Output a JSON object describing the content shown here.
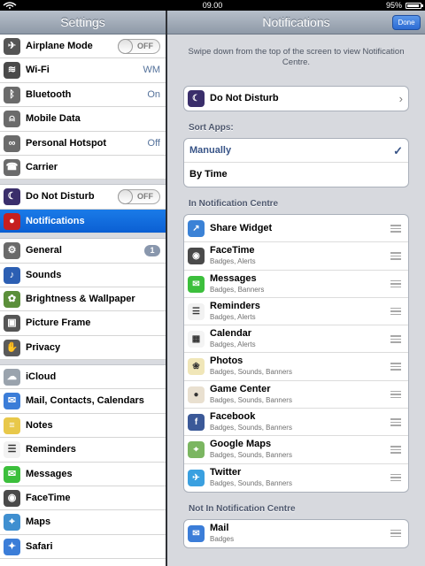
{
  "status": {
    "time": "09.00",
    "battery_text": "95%",
    "battery_level": 0.95
  },
  "left": {
    "title": "Settings",
    "groups": [
      [
        {
          "label": "Airplane Mode",
          "icon": "airplane-icon",
          "color": "#555555",
          "toggle": "OFF"
        },
        {
          "label": "Wi-Fi",
          "icon": "wifi-icon",
          "color": "#4a4a4a",
          "value": "WM"
        },
        {
          "label": "Bluetooth",
          "icon": "bluetooth-icon",
          "color": "#6b6b6b",
          "value": "On"
        },
        {
          "label": "Mobile Data",
          "icon": "mobile-data-icon",
          "color": "#6b6b6b"
        },
        {
          "label": "Personal Hotspot",
          "icon": "hotspot-icon",
          "color": "#6b6b6b",
          "value": "Off"
        },
        {
          "label": "Carrier",
          "icon": "phone-icon",
          "color": "#6b6b6b"
        }
      ],
      [
        {
          "label": "Do Not Disturb",
          "icon": "moon-icon",
          "color": "#3a2e6b",
          "toggle": "OFF"
        },
        {
          "label": "Notifications",
          "icon": "notifications-icon",
          "color": "#c61f1f",
          "selected": true
        }
      ],
      [
        {
          "label": "General",
          "icon": "gear-icon",
          "color": "#6a6a6a",
          "badge": "1"
        },
        {
          "label": "Sounds",
          "icon": "speaker-icon",
          "color": "#2c5fb3"
        },
        {
          "label": "Brightness & Wallpaper",
          "icon": "flower-icon",
          "color": "#5b8f3a"
        },
        {
          "label": "Picture Frame",
          "icon": "picture-frame-icon",
          "color": "#555555"
        },
        {
          "label": "Privacy",
          "icon": "hand-icon",
          "color": "#5a5a5a"
        }
      ],
      [
        {
          "label": "iCloud",
          "icon": "cloud-icon",
          "color": "#9aa3ad"
        },
        {
          "label": "Mail, Contacts, Calendars",
          "icon": "mail-icon",
          "color": "#3b7dd8"
        },
        {
          "label": "Notes",
          "icon": "notes-icon",
          "color": "#e8c84a"
        },
        {
          "label": "Reminders",
          "icon": "reminders-icon",
          "color": "#f2f2f2"
        },
        {
          "label": "Messages",
          "icon": "messages-icon",
          "color": "#3cbf3c"
        },
        {
          "label": "FaceTime",
          "icon": "facetime-icon",
          "color": "#4a4a4a"
        },
        {
          "label": "Maps",
          "icon": "maps-icon",
          "color": "#3f8fd0"
        },
        {
          "label": "Safari",
          "icon": "safari-icon",
          "color": "#3b7dd8"
        }
      ]
    ]
  },
  "right": {
    "title": "Notifications",
    "done_label": "Done",
    "hint": "Swipe down from the top of the screen to view Notification Centre.",
    "dnd_label": "Do Not Disturb",
    "sort_header": "Sort Apps:",
    "sort_options": [
      {
        "label": "Manually",
        "checked": true,
        "check_glyph": "✓"
      },
      {
        "label": "By Time",
        "checked": false
      }
    ],
    "in_header": "In Notification Centre",
    "in_apps": [
      {
        "name": "Share Widget",
        "sub": "",
        "icon": "share-icon",
        "color": "#3b82d6"
      },
      {
        "name": "FaceTime",
        "sub": "Badges, Alerts",
        "icon": "facetime-icon",
        "color": "#4a4a4a"
      },
      {
        "name": "Messages",
        "sub": "Badges, Banners",
        "icon": "messages-icon",
        "color": "#3cbf3c"
      },
      {
        "name": "Reminders",
        "sub": "Badges, Alerts",
        "icon": "reminders-icon",
        "color": "#f2f2f2"
      },
      {
        "name": "Calendar",
        "sub": "Badges, Alerts",
        "icon": "calendar-icon",
        "color": "#f4f4f4"
      },
      {
        "name": "Photos",
        "sub": "Badges, Sounds, Banners",
        "icon": "photos-icon",
        "color": "#f0e6b8"
      },
      {
        "name": "Game Center",
        "sub": "Badges, Sounds, Banners",
        "icon": "game-center-icon",
        "color": "#e9e0d0"
      },
      {
        "name": "Facebook",
        "sub": "Badges, Sounds, Banners",
        "icon": "facebook-icon",
        "color": "#3b5998"
      },
      {
        "name": "Google Maps",
        "sub": "Badges, Sounds, Banners",
        "icon": "google-maps-icon",
        "color": "#7bb661"
      },
      {
        "name": "Twitter",
        "sub": "Badges, Sounds, Banners",
        "icon": "twitter-icon",
        "color": "#3aa0e0"
      }
    ],
    "out_header": "Not In Notification Centre",
    "out_apps": [
      {
        "name": "Mail",
        "sub": "Badges",
        "icon": "mail-icon",
        "color": "#3b7dd8"
      }
    ]
  }
}
